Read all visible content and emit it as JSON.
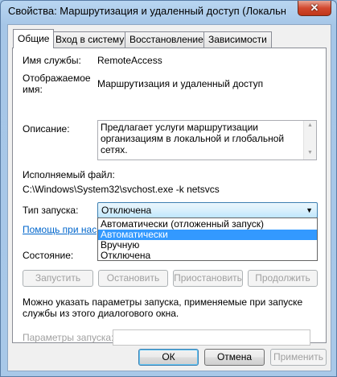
{
  "window": {
    "title": "Свойства: Маршрутизация и удаленный доступ (Локальный ко...",
    "close_label": "✕"
  },
  "tabs": [
    {
      "label": "Общие",
      "active": true
    },
    {
      "label": "Вход в систему",
      "active": false
    },
    {
      "label": "Восстановление",
      "active": false
    },
    {
      "label": "Зависимости",
      "active": false
    }
  ],
  "general": {
    "service_name_label": "Имя службы:",
    "service_name": "RemoteAccess",
    "display_name_label_1": "Отображаемое",
    "display_name_label_2": "имя:",
    "display_name": "Маршрутизация и удаленный доступ",
    "description_label": "Описание:",
    "description": "Предлагает услуги маршрутизации организациям в локальной и глобальной сетях.",
    "exe_label": "Исполняемый файл:",
    "exe_path": "C:\\Windows\\System32\\svchost.exe -k netsvcs",
    "startup_type_label": "Тип запуска:",
    "startup_type_value": "Отключена",
    "startup_options": [
      "Автоматически (отложенный запуск)",
      "Автоматически",
      "Вручную",
      "Отключена"
    ],
    "help_link": "Помощь при настройке параметров запуска служб.",
    "status_label": "Состояние:",
    "buttons": {
      "start": "Запустить",
      "stop": "Остановить",
      "pause": "Приостановить",
      "resume": "Продолжить"
    },
    "hint_line1": "Можно указать параметры запуска, применяемые при запуске",
    "hint_line2": "службы из этого диалогового окна.",
    "start_params_label": "Параметры запуска:",
    "start_params_value": ""
  },
  "footer": {
    "ok": "ОК",
    "cancel": "Отмена",
    "apply": "Применить"
  }
}
